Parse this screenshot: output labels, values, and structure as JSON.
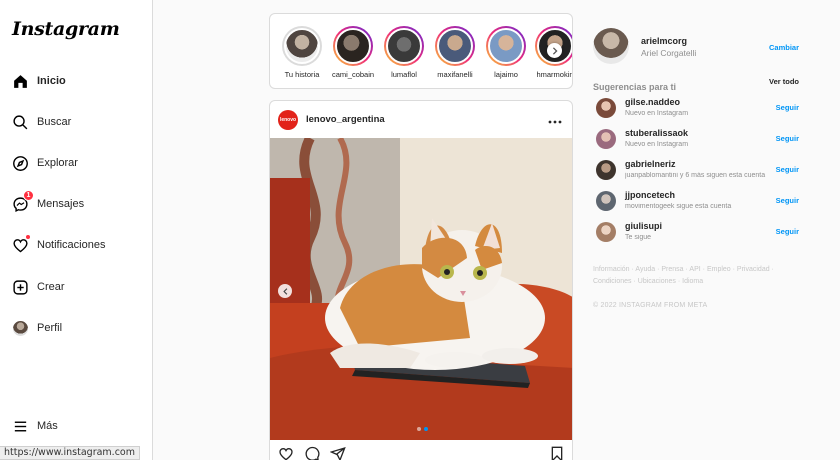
{
  "app": {
    "logo": "Instagram"
  },
  "sidebar": {
    "items": [
      {
        "label": "Inicio",
        "icon": "home-icon",
        "active": true
      },
      {
        "label": "Buscar",
        "icon": "search-icon"
      },
      {
        "label": "Explorar",
        "icon": "compass-icon"
      },
      {
        "label": "Mensajes",
        "icon": "messenger-icon",
        "badge": "1"
      },
      {
        "label": "Notificaciones",
        "icon": "heart-icon"
      },
      {
        "label": "Crear",
        "icon": "plus-square-icon"
      },
      {
        "label": "Perfil",
        "icon": "avatar"
      },
      {
        "label": "Más",
        "icon": "menu-icon"
      }
    ]
  },
  "statusbar": {
    "url": "https://www.instagram.com"
  },
  "stories": [
    {
      "name": "Tu historia",
      "seen": true
    },
    {
      "name": "cami_cobain"
    },
    {
      "name": "lumaflol"
    },
    {
      "name": "maxifanelli"
    },
    {
      "name": "lajaimo"
    },
    {
      "name": "hmarmokin"
    }
  ],
  "post": {
    "username": "lenovo_argentina",
    "avatar_text": "lenovo",
    "image_count": 2,
    "image_index": 2
  },
  "account": {
    "username": "arielmcorg",
    "full_name": "Ariel Corgatelli",
    "switch_label": "Cambiar"
  },
  "suggestions": {
    "title": "Sugerencias para ti",
    "see_all": "Ver todo",
    "follow_label": "Seguir",
    "items": [
      {
        "username": "gilse.naddeo",
        "subtitle": "Nuevo en Instagram",
        "color": "#c98a7a"
      },
      {
        "username": "stuberalissaok",
        "subtitle": "Nuevo en Instagram",
        "color": "#b07a8e"
      },
      {
        "username": "gabrielneriz",
        "subtitle": "juanpablomantini y 6 más siguen esta cuenta",
        "color": "#6b5a4e"
      },
      {
        "username": "jjponcetech",
        "subtitle": "movimentogeek sigue esta cuenta",
        "color": "#8a8f96"
      },
      {
        "username": "giulisupi",
        "subtitle": "Te sigue",
        "color": "#c4a08a"
      }
    ]
  },
  "footer": {
    "links": [
      "Información",
      "Ayuda",
      "Prensa",
      "API",
      "Empleo",
      "Privacidad",
      "Condiciones",
      "Ubicaciones",
      "Idioma"
    ],
    "copyright": "© 2022 INSTAGRAM FROM META"
  }
}
